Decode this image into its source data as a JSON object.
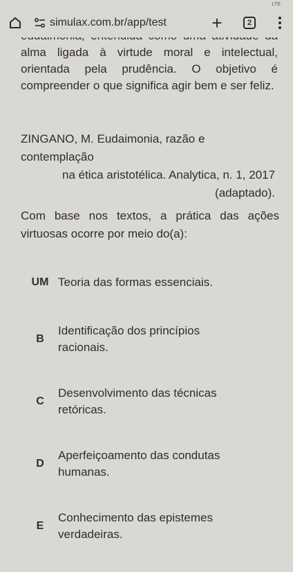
{
  "status_bar": {
    "network": "LTE"
  },
  "browser": {
    "url": "simulax.com.br/app/test",
    "tab_count": "2"
  },
  "passage": {
    "paragraph": "eudaimonia, entendida como uma atividade da alma ligada à virtude moral e intelectual, orientada pela prudência. O objetivo é compreender o que significa agir bem e ser feliz."
  },
  "citation": {
    "line1": "ZINGANO, M. Eudaimonia, razão e contemplação",
    "line2": "na ética aristotélica. Analytica, n. 1, 2017",
    "line3": "(adaptado)."
  },
  "question": {
    "text": "Com base nos textos, a prática das ações virtuosas ocorre por meio do(a):"
  },
  "options": [
    {
      "letter": "UM",
      "text": "Teoria das formas essenciais."
    },
    {
      "letter": "B",
      "text": "Identificação dos princípios racionais."
    },
    {
      "letter": "C",
      "text": "Desenvolvimento das técnicas retóricas."
    },
    {
      "letter": "D",
      "text": "Aperfeiçoamento das condutas humanas."
    },
    {
      "letter": "E",
      "text": "Conhecimento das epistemes verdadeiras."
    }
  ]
}
